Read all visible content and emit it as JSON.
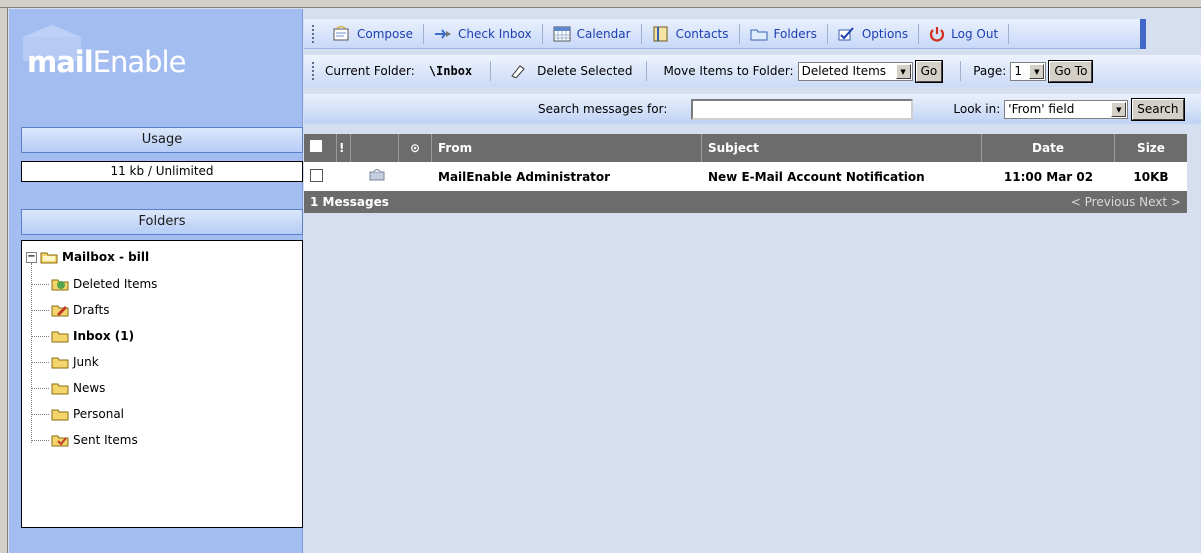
{
  "brand": {
    "logo_bold": "mail",
    "logo_light": "Enable"
  },
  "sidebar": {
    "usage_title": "Usage",
    "usage_value": "11 kb / Unlimited",
    "folders_title": "Folders",
    "root": "Mailbox - bill",
    "items": [
      {
        "label": "Deleted Items",
        "icon": "recycle-folder-icon"
      },
      {
        "label": "Drafts",
        "icon": "drafts-folder-icon"
      },
      {
        "label": "Inbox (1)",
        "icon": "inbox-folder-icon"
      },
      {
        "label": "Junk",
        "icon": "folder-icon"
      },
      {
        "label": "News",
        "icon": "folder-icon"
      },
      {
        "label": "Personal",
        "icon": "folder-icon"
      },
      {
        "label": "Sent Items",
        "icon": "sent-folder-icon"
      }
    ]
  },
  "toolbar": {
    "compose": "Compose",
    "check_inbox": "Check Inbox",
    "calendar": "Calendar",
    "contacts": "Contacts",
    "folders": "Folders",
    "options": "Options",
    "logout": "Log Out"
  },
  "actions": {
    "current_folder_label": "Current Folder:",
    "current_folder": "\\Inbox",
    "delete_selected": "Delete Selected",
    "move_label": "Move Items to Folder:",
    "move_value": "Deleted Items",
    "go": "Go",
    "page_label": "Page:",
    "page_value": "1",
    "go_to": "Go To"
  },
  "search": {
    "label": "Search messages for:",
    "value": "",
    "look_in_label": "Look in:",
    "look_in_value": "'From' field",
    "button": "Search"
  },
  "grid": {
    "headers": {
      "from": "From",
      "subject": "Subject",
      "date": "Date",
      "size": "Size"
    },
    "rows": [
      {
        "from": "MailEnable Administrator",
        "subject": "New E-Mail Account Notification",
        "date": "11:00 Mar 02",
        "size": "10KB"
      }
    ],
    "footer_count": "1 Messages",
    "footer_nav": "< Previous  Next >"
  }
}
